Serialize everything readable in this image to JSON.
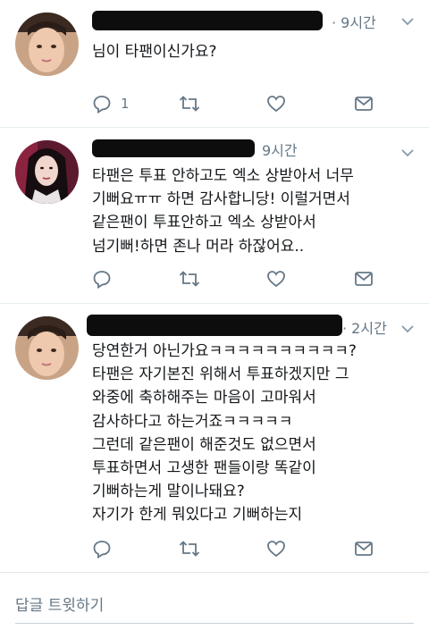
{
  "tweets": [
    {
      "time": "· 9시간",
      "text": "님이 타팬이신가요?",
      "reply_count": "1"
    },
    {
      "time": "9시간",
      "text": "타팬은 투표 안하고도 엑소 상받아서 너무\n기뻐요ㅠㅠ 하면 감사합니당! 이럴거면서\n같은팬이 투표안하고 엑소 상받아서\n넘기뻐!하면 존나 머라 하잖어요..",
      "reply_count": ""
    },
    {
      "time": "· 2시간",
      "text": "당연한거 아닌가요ㅋㅋㅋㅋㅋㅋㅋㅋㅋㅋ?\n타팬은 자기본진 위해서 투표하겠지만 그\n와중에 축하해주는 마음이 고마워서\n감사하다고 하는거죠ㅋㅋㅋㅋㅋ\n그런데 같은팬이 해준것도 없으면서\n투표하면서 고생한 팬들이랑 똑같이\n기뻐하는게 말이나돼요?\n자기가 한게 뭐있다고 기뻐하는지",
      "reply_count": ""
    }
  ],
  "reply": {
    "placeholder": "답글 트윗하기"
  },
  "colors": {
    "text": "#14171a",
    "muted": "#657786",
    "divider": "#e6ecf0"
  },
  "icons": [
    "reply-icon",
    "retweet-icon",
    "like-icon",
    "dm-icon",
    "chevron-down-icon"
  ]
}
